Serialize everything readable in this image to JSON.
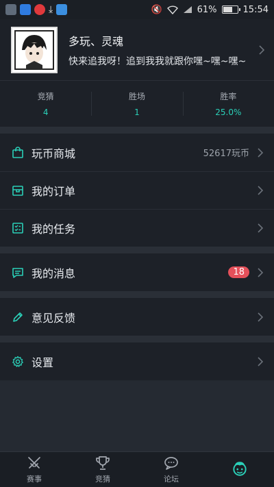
{
  "status_bar": {
    "battery": "61%",
    "time": "15:54"
  },
  "profile": {
    "name": "多玩、灵魂",
    "signature": "快来追我呀！追到我我就跟你嘿~嘿~嘿~"
  },
  "stats": [
    {
      "label": "竞猜",
      "value": "4"
    },
    {
      "label": "胜场",
      "value": "1"
    },
    {
      "label": "胜率",
      "value": "25.0%"
    }
  ],
  "menu": {
    "shop": {
      "label": "玩币商城",
      "value": "52617玩币"
    },
    "orders": {
      "label": "我的订单"
    },
    "tasks": {
      "label": "我的任务"
    },
    "messages": {
      "label": "我的消息",
      "badge": "18"
    },
    "feedback": {
      "label": "意见反馈"
    },
    "settings": {
      "label": "设置"
    }
  },
  "tabs": [
    {
      "label": "赛事",
      "icon": "swords-icon"
    },
    {
      "label": "竞猜",
      "icon": "trophy-icon"
    },
    {
      "label": "论坛",
      "icon": "chat-bubble-icon"
    },
    {
      "label": "",
      "icon": "profile-face-icon",
      "active": true
    }
  ],
  "colors": {
    "accent": "#2bd0b8",
    "badge": "#e4505a",
    "background": "#23272f"
  }
}
